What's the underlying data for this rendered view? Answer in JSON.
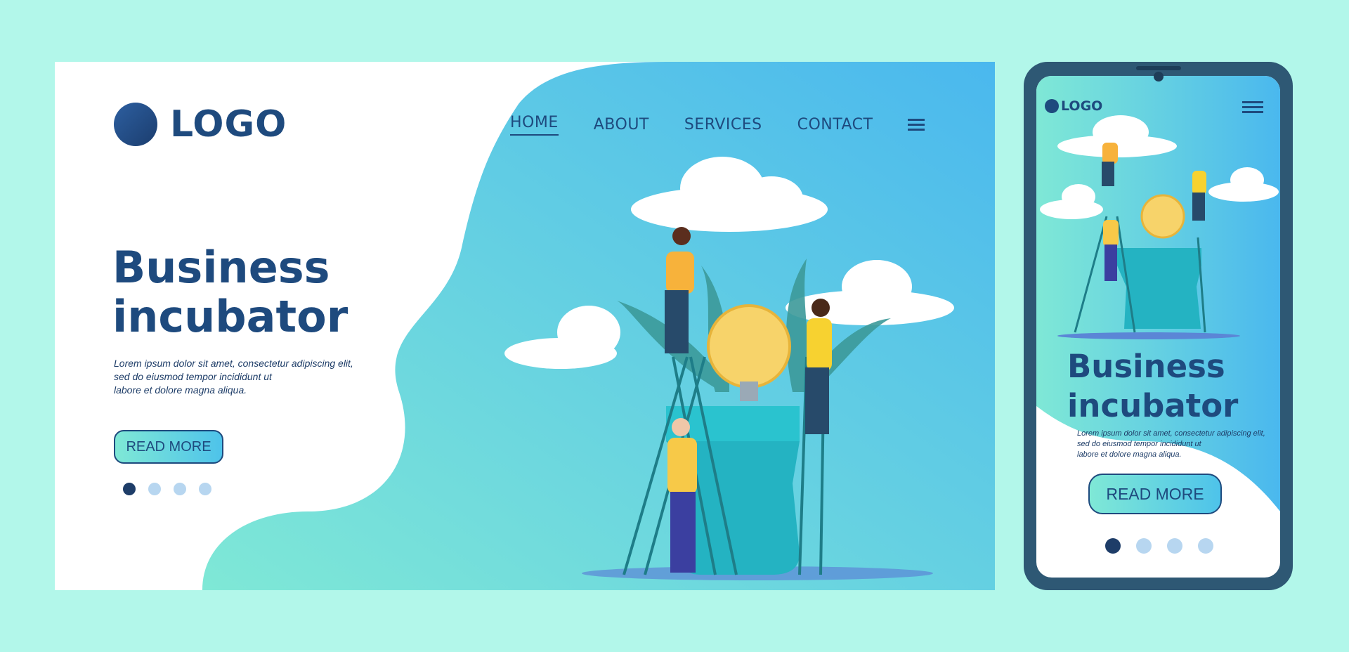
{
  "colors": {
    "page_bg": "#b2f7ea",
    "primary": "#1e4a7e",
    "gradient_start": "#7fe8d6",
    "gradient_end": "#4ec3ea",
    "phone_frame": "#2e5874",
    "accent_yellow": "#f7c948"
  },
  "desktop": {
    "logo": "LOGO",
    "nav": [
      {
        "label": "HOME",
        "active": true
      },
      {
        "label": "ABOUT"
      },
      {
        "label": "SERVICES"
      },
      {
        "label": "CONTACT"
      }
    ],
    "menu_icon": "hamburger-icon",
    "title_line1": "Business",
    "title_line2": "incubator",
    "lorem": [
      "Lorem ipsum dolor sit amet, consectetur adipiscing elit,",
      "sed do eiusmod tempor incididunt ut",
      "labore et dolore magna aliqua."
    ],
    "button": "READ MORE",
    "pagination": {
      "total": 4,
      "active": 1
    }
  },
  "mobile": {
    "logo": "LOGO",
    "menu_icon": "hamburger-icon",
    "title_line1": "Business",
    "title_line2": "incubator",
    "lorem": [
      "Lorem ipsum dolor sit amet, consectetur adipiscing elit,",
      "sed do eiusmod tempor incididunt ut",
      "labore et dolore magna aliqua."
    ],
    "button": "READ MORE",
    "pagination": {
      "total": 4,
      "active": 1
    }
  }
}
